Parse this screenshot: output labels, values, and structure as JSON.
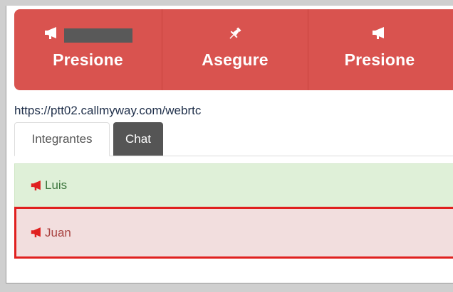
{
  "colors": {
    "toolbar_bg": "#d9534f",
    "member_ok_bg": "#dff0d8",
    "member_ok_text": "#3c763d",
    "member_alert_bg": "#f2dede",
    "member_alert_text": "#a94442",
    "member_alert_border": "#e0201f",
    "active_tab_bg": "#555555"
  },
  "toolbar": {
    "buttons": [
      {
        "icon": "megaphone-icon",
        "label": "Presione",
        "has_redacted_caption": true
      },
      {
        "icon": "pin-icon",
        "label": "Asegure"
      },
      {
        "icon": "megaphone-icon",
        "label": "Presione"
      }
    ]
  },
  "url": "https://ptt02.callmyway.com/webrtc",
  "tabs": [
    {
      "label": "Integrantes"
    },
    {
      "label": "Chat",
      "active": true
    }
  ],
  "members": [
    {
      "name": "Luis",
      "icon": "megaphone-icon",
      "state": "ok"
    },
    {
      "name": "Juan",
      "icon": "megaphone-icon",
      "state": "alert"
    }
  ]
}
